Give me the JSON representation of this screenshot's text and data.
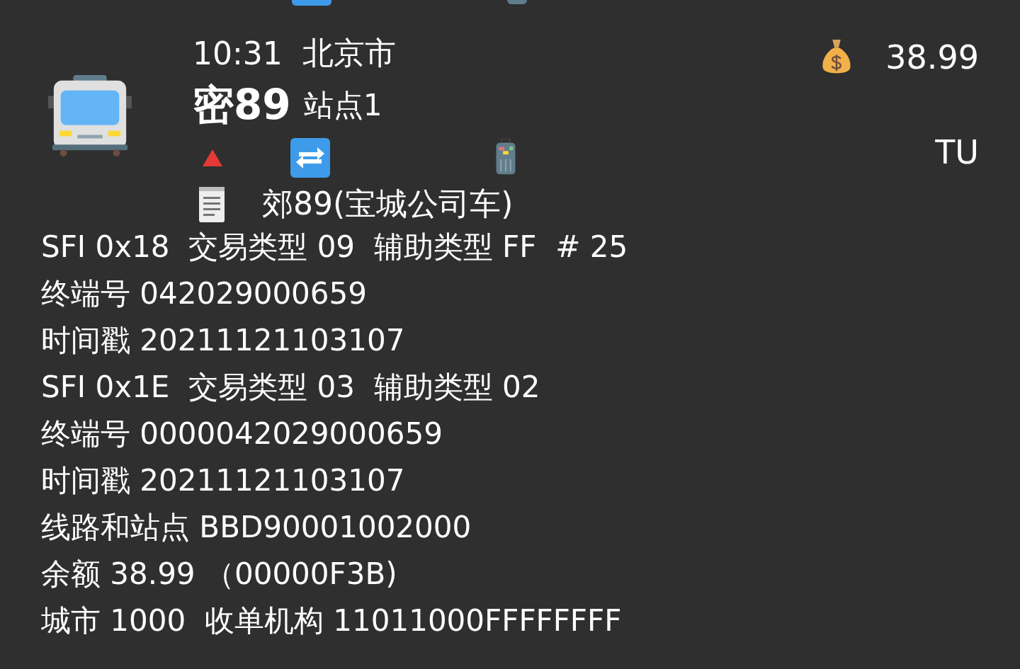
{
  "header": {
    "time": "10:31",
    "city": "北京市",
    "line": "密89",
    "station": "站点1",
    "balance": "38.99",
    "card_type": "TU",
    "route_name": "郊89(宝城公司车)"
  },
  "records": [
    {
      "text": "SFI 0x18  交易类型 09  辅助类型 FF  # 25"
    },
    {
      "text": "终端号 042029000659"
    },
    {
      "text": "时间戳 20211121103107"
    },
    {
      "text": "SFI 0x1E  交易类型 03  辅助类型 02"
    },
    {
      "text": "终端号 0000042029000659"
    },
    {
      "text": "时间戳 20211121103107"
    },
    {
      "text": "线路和站点 BBD90001002000"
    },
    {
      "text": "余额 38.99 （00000F3B)"
    },
    {
      "text": "城市 1000  收单机构 11011000FFFFFFFF"
    }
  ]
}
